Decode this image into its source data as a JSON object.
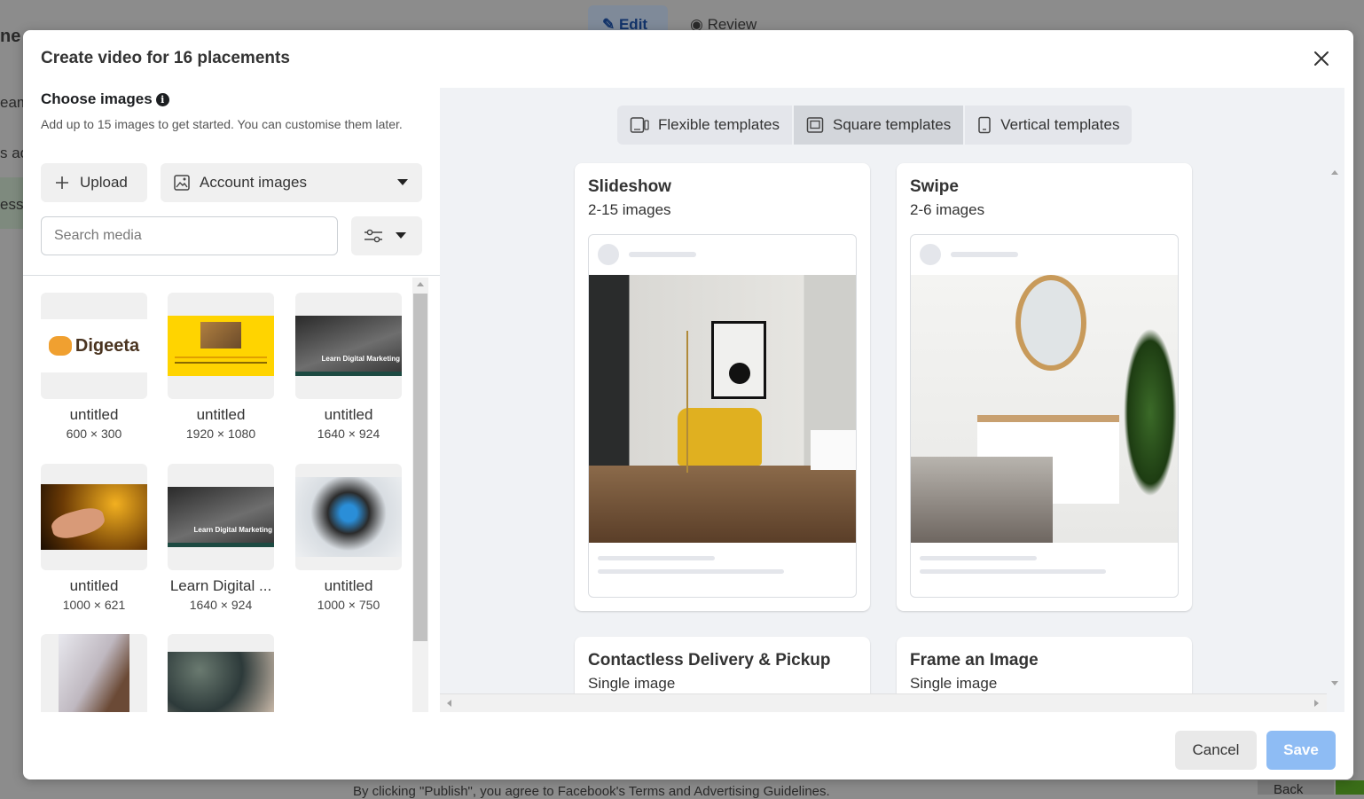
{
  "background": {
    "partial_title": "ne",
    "edit_label": "Edit",
    "review_label": "Review",
    "side_texts": [
      "eam",
      "s ac",
      "ess"
    ],
    "footer_text": "By clicking \"Publish\", you agree to Facebook's Terms and Advertising Guidelines.",
    "back_label": "Back"
  },
  "modal": {
    "title": "Create video for 16 placements",
    "close_icon": "close-icon",
    "choose_images": {
      "heading": "Choose images",
      "info_icon": "info-icon",
      "description": "Add up to 15 images to get started. You can customise them later.",
      "upload_label": "Upload",
      "account_images_label": "Account images",
      "search_placeholder": "Search media"
    },
    "images": [
      {
        "name": "untitled",
        "dimensions": "600 × 300",
        "logo_text": "Digeeta"
      },
      {
        "name": "untitled",
        "dimensions": "1920 × 1080"
      },
      {
        "name": "untitled",
        "dimensions": "1640 × 924",
        "overlay_text": "Learn Digital Marketing"
      },
      {
        "name": "untitled",
        "dimensions": "1000 × 621"
      },
      {
        "name": "Learn Digital ...",
        "dimensions": "1640 × 924",
        "overlay_text": "Learn Digital Marketing"
      },
      {
        "name": "untitled",
        "dimensions": "1000 × 750"
      },
      {
        "name": "",
        "dimensions": ""
      },
      {
        "name": "",
        "dimensions": ""
      }
    ],
    "template_tabs": [
      {
        "label": "Flexible templates",
        "icon": "flexible-device-icon",
        "active": false
      },
      {
        "label": "Square templates",
        "icon": "square-device-icon",
        "active": true
      },
      {
        "label": "Vertical templates",
        "icon": "phone-icon",
        "active": false
      }
    ],
    "templates": [
      {
        "title": "Slideshow",
        "subtitle": "2-15 images"
      },
      {
        "title": "Swipe",
        "subtitle": "2-6 images"
      },
      {
        "title": "Contactless Delivery & Pickup",
        "subtitle": "Single image"
      },
      {
        "title": "Frame an Image",
        "subtitle": "Single image"
      }
    ],
    "cancel_label": "Cancel",
    "save_label": "Save",
    "colors": {
      "save_disabled": "#8ebcf4",
      "panel_bg": "#f0f2f5"
    }
  }
}
